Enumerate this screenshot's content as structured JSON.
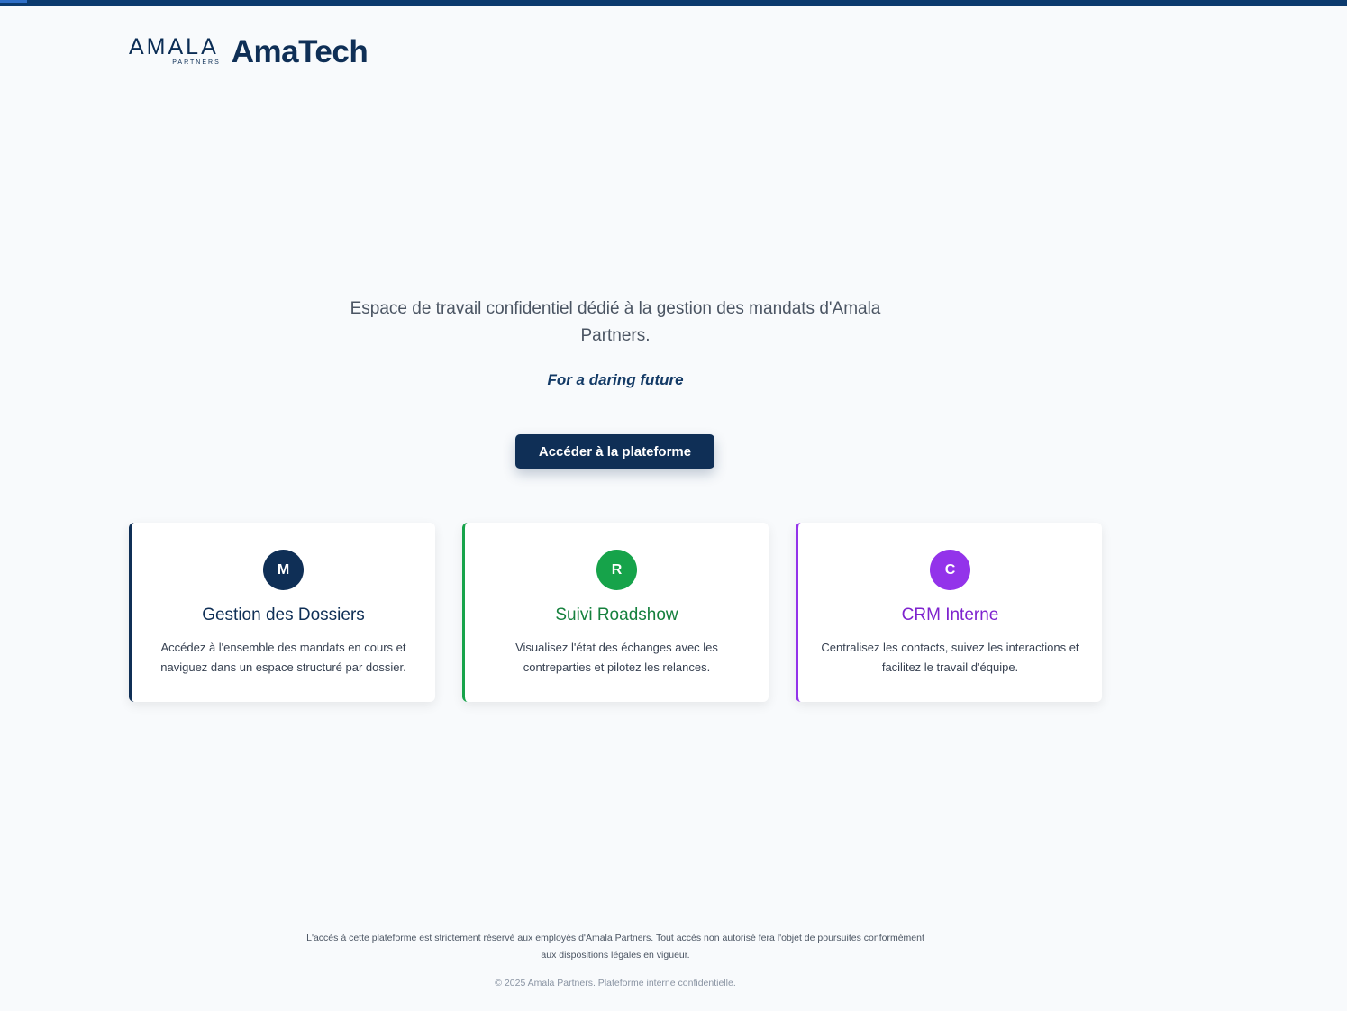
{
  "header": {
    "logo_text": "AMALA",
    "logo_subtext": "PARTNERS",
    "app_name": "AmaTech"
  },
  "hero": {
    "intro": "Espace de travail confidentiel dédié à la gestion des mandats d'Amala Partners.",
    "slogan": "For a daring future",
    "cta_label": "Accéder à la plateforme"
  },
  "colors": {
    "brand": "#0f2f56",
    "roadshow": "#16a34a",
    "crm": "#9333ea"
  },
  "cards": [
    {
      "avatar": "M",
      "title": "Gestion des Dossiers",
      "description": "Accédez à l'ensemble des mandats en cours et naviguez dans un espace structuré par dossier.",
      "color": "#0f2f56",
      "title_color": "#0f2f56"
    },
    {
      "avatar": "R",
      "title": "Suivi Roadshow",
      "description": "Visualisez l'état des échanges avec les contreparties et pilotez les relances.",
      "color": "#16a34a",
      "title_color": "#15803d"
    },
    {
      "avatar": "C",
      "title": "CRM Interne",
      "description": "Centralisez les contacts, suivez les interactions et facilitez le travail d'équipe.",
      "color": "#9333ea",
      "title_color": "#7e22ce"
    }
  ],
  "footer": {
    "notice": "L'accès à cette plateforme est strictement réservé aux employés d'Amala Partners. Tout accès non autorisé fera l'objet de poursuites conformément aux dispositions légales en vigueur.",
    "copyright": "© 2025 Amala Partners. Plateforme interne confidentielle."
  }
}
